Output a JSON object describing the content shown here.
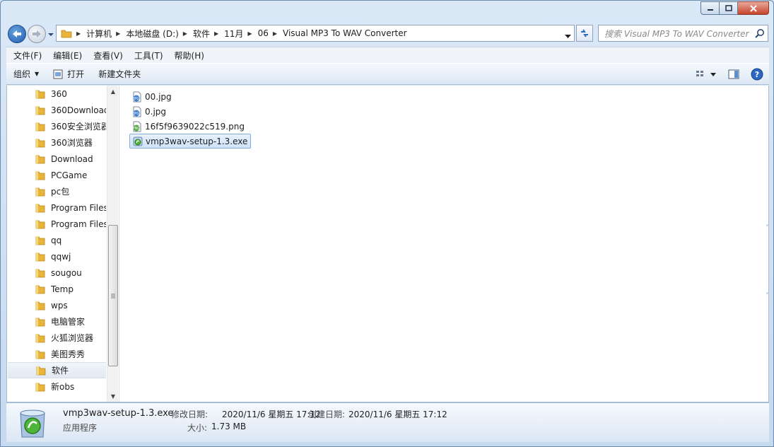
{
  "address": {
    "crumbs": [
      "计算机",
      "本地磁盘 (D:)",
      "软件",
      "11月",
      "06",
      "Visual MP3 To WAV Converter"
    ]
  },
  "search": {
    "placeholder": "搜索 Visual MP3 To WAV Converter"
  },
  "menu": {
    "items": [
      "文件(F)",
      "编辑(E)",
      "查看(V)",
      "工具(T)",
      "帮助(H)"
    ]
  },
  "commands": {
    "organize": "组织",
    "open": "打开",
    "new_folder": "新建文件夹"
  },
  "tree": {
    "items": [
      "360",
      "360Download",
      "360安全浏览器",
      "360浏览器",
      "Download",
      "PCGame",
      "pc包",
      "Program Files",
      "Program Files",
      "qq",
      "qqwj",
      "sougou",
      "Temp",
      "wps",
      "电脑管家",
      "火狐浏览器",
      "美图秀秀",
      "软件",
      "新obs"
    ],
    "selected": "软件"
  },
  "files": [
    {
      "name": "00.jpg",
      "type": "jpg"
    },
    {
      "name": "0.jpg",
      "type": "jpg"
    },
    {
      "name": "16f5f9639022c519.png",
      "type": "png"
    },
    {
      "name": "vmp3wav-setup-1.3.exe",
      "type": "exe",
      "selected": true
    }
  ],
  "details": {
    "name": "vmp3wav-setup-1.3.exe",
    "kind": "应用程序",
    "modified_label": "修改日期:",
    "modified": "2020/11/6 星期五 17:12",
    "created_label": "创建日期:",
    "created": "2020/11/6 星期五 17:12",
    "size_label": "大小:",
    "size": "1.73 MB"
  },
  "colors": {
    "accent": "#1f5fb0",
    "selection": "#cfe2f9",
    "folder": "#e8b43a"
  }
}
